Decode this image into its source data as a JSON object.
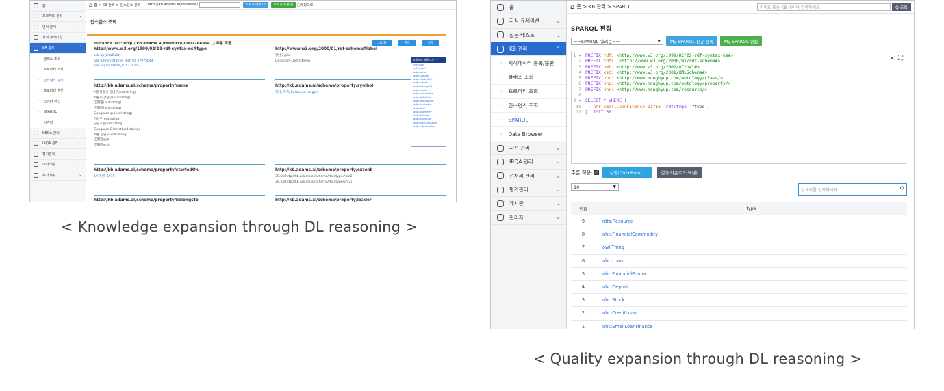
{
  "shot1": {
    "sidebar": [
      {
        "label": "홈",
        "active": false,
        "chev": false
      },
      {
        "label": "프로젝트 관리",
        "active": false,
        "chev": true
      },
      {
        "label": "언어 분석",
        "active": false,
        "chev": true
      },
      {
        "label": "지식 큐레이션",
        "active": false,
        "chev": true
      },
      {
        "label": "KB 관리",
        "active": true,
        "chev": true
      }
    ],
    "submenu": [
      {
        "label": "클래스 조회",
        "current": false
      },
      {
        "label": "프로퍼티 조회",
        "current": false
      },
      {
        "label": "인스턴스 관리",
        "current": true
      },
      {
        "label": "프로퍼티 추천",
        "current": false
      },
      {
        "label": "스키마 편집",
        "current": false
      },
      {
        "label": "SPARQL",
        "current": false
      },
      {
        "label": "시각화",
        "current": false
      }
    ],
    "sidebar_after": [
      {
        "label": "KBQA 관리"
      },
      {
        "label": "IRQA 관리"
      },
      {
        "label": "평가관리"
      },
      {
        "label": "모니터링"
      },
      {
        "label": "부가메뉴"
      }
    ],
    "breadcrumb": "홈 > KB 관리 > 인스턴스 관리",
    "url_text": "http://kb.adams.ai/resource/",
    "go_btn": "바로가기(新기)",
    "go_edit_btn": "바로가기(편집)",
    "new_window": "새창으로",
    "page_title": "인스턴스 조회",
    "instance_uri": "Instance URI: http://kb.adams.ai/resource/0000266994 □ 추론 적용",
    "action_buttons": [
      "시각화",
      "편집",
      "삭제"
    ],
    "cards": [
      {
        "head": "http://www.w3.org/1999/02/22-rdf-syntax-ns#type",
        "lines": [
          {
            "t": "adc:sp_GeoEntity -",
            "link": true
          },
          {
            "t": "adc:administrative_district_07975644 -",
            "link": true
          },
          {
            "t": "adc:organization_07523126 -",
            "link": true
          }
        ]
      },
      {
        "head": "http://www.w3.org/2000/01/rdf-schema#label",
        "lines": [
          {
            "t": "강남구@ko",
            "link": false
          },
          {
            "t": "Gangnam-District@en",
            "link": false
          }
        ]
      },
      {
        "head": "http://kb.adams.ai/schema/property/name",
        "lines": [
          {
            "t": "서울특별시 강남구(xsd:string)",
            "link": false
          },
          {
            "t": "서울시 강남구(xsd:string)",
            "link": false
          },
          {
            "t": "江南區(xsd:string)",
            "link": false
          },
          {
            "t": "江南区(xsd:string)",
            "link": false
          },
          {
            "t": "Gangnam-gu(xsd:string)",
            "link": false
          },
          {
            "t": "강남구(xsd:string)",
            "link": false
          },
          {
            "t": "강남구청(xsd:string)",
            "link": false
          },
          {
            "t": "Gangnam-District(xsd:string)",
            "link": false
          },
          {
            "t": "서울 강남구(xsd:string)",
            "link": false
          },
          {
            "t": "江南区@ja",
            "link": false
          },
          {
            "t": "江南区@zh",
            "link": false
          }
        ]
      },
      {
        "head": "http://kb.adams.ai/schema/property/symbol",
        "lines": [
          {
            "t": "까치, 까치, European magpie",
            "link": true
          }
        ]
      },
      {
        "head": "http://kb.adams.ai/schema/property/startedOn",
        "lines": [
          {
            "t": "1975년, 1975",
            "link": true
          }
        ]
      },
      {
        "head": "http://kb.adams.ai/schema/property/extent",
        "lines": [
          {
            "t": "39.55(http://kb.adams.ai/schema/datatype#km2)",
            "link": false
          },
          {
            "t": "39.55(http://kb.adams.ai/schema/datatype/km2)",
            "link": false
          }
        ]
      },
      {
        "head": "http://kb.adams.ai/schema/property/belongsTo",
        "lines": []
      },
      {
        "head": "http://kb.adams.ai/schema/property/leader",
        "lines": []
      }
    ],
    "dropdown_title": "프로퍼티 바로가기 ⋯",
    "dropdown_options": [
      "rdf:type",
      "rdfs:label",
      "adp:name",
      "adp:symbol",
      "adp:startedOn",
      "adp:extent",
      "adp:belongsTo",
      "adp:leader",
      "adp:coordinate",
      "adp:definition",
      "adp:description",
      "adp:locatedIn",
      "adp:field",
      "adp:geometry",
      "adp:latitude",
      "adp:longitude",
      "adp:mainLocation",
      "adp:subLocation"
    ]
  },
  "shot2": {
    "sidebar": [
      {
        "label": "홈",
        "active": false,
        "chev": false
      },
      {
        "label": "지식 큐레이션",
        "active": false,
        "chev": true
      },
      {
        "label": "질문 테스트",
        "active": false,
        "chev": true
      },
      {
        "label": "KB 관리",
        "active": true,
        "chev": true
      }
    ],
    "submenu": [
      {
        "label": "지식데이터 등록/출판",
        "current": false
      },
      {
        "label": "클래스 조회",
        "current": false
      },
      {
        "label": "프로퍼티 조회",
        "current": false
      },
      {
        "label": "인스턴스 조회",
        "current": false
      },
      {
        "label": "SPARQL",
        "current": true
      },
      {
        "label": "Data Browser",
        "current": false
      }
    ],
    "sidebar_after": [
      {
        "label": "사전 관리"
      },
      {
        "label": "IRQA 관리"
      },
      {
        "label": "전처리 관리"
      },
      {
        "label": "평가관리"
      },
      {
        "label": "게시판"
      },
      {
        "label": "관리자"
      }
    ],
    "breadcrumb": "홈 > KB 관리 > SPARQL",
    "search_placeholder": "키워드 또는 KB 데이터 입력하세요",
    "search_btn": "Q 조회",
    "page_title": "SPARQL 편집",
    "query_select": "==SPARQL 쿼리문==",
    "btn_register": "My SPARQL 신규 등록",
    "btn_edit": "My SPARQL 편집",
    "code": [
      {
        "no": "1 ▸",
        "parts": [
          [
            "kw",
            "PREFIX "
          ],
          [
            "vr",
            "rdf: "
          ],
          [
            "ur",
            "<http://www.w3.org/1999/02/22-rdf-syntax-ns#>"
          ]
        ]
      },
      {
        "no": "2",
        "parts": [
          [
            "kw",
            "PREFIX "
          ],
          [
            "vr",
            "rdfs: "
          ],
          [
            "ur",
            "<http://www.w3.org/2000/01/rdf-schema#>"
          ]
        ]
      },
      {
        "no": "3",
        "parts": [
          [
            "kw",
            "PREFIX "
          ],
          [
            "vr",
            "owl: "
          ],
          [
            "ur",
            "<http://www.w3.org/2002/07/owl#>"
          ]
        ]
      },
      {
        "no": "4",
        "parts": [
          [
            "kw",
            "PREFIX "
          ],
          [
            "vr",
            "xsd: "
          ],
          [
            "ur",
            "<http://www.w3.org/2001/XMLSchema#>"
          ]
        ]
      },
      {
        "no": "5",
        "parts": [
          [
            "kw",
            "PREFIX "
          ],
          [
            "vr",
            "nhc: "
          ],
          [
            "ur",
            "<http://www.nonghyup.com/ontology/class/>"
          ]
        ]
      },
      {
        "no": "6",
        "parts": [
          [
            "kw",
            "PREFIX "
          ],
          [
            "vr",
            "nhp: "
          ],
          [
            "ur",
            "<http://www.nonghyup.com/ontology/property/>"
          ]
        ]
      },
      {
        "no": "7",
        "parts": [
          [
            "kw",
            "PREFIX "
          ],
          [
            "vr",
            "nhr: "
          ],
          [
            "ur",
            "<http://www.nonghyup.com/resource/>"
          ]
        ]
      },
      {
        "no": "8",
        "parts": []
      },
      {
        "no": "9 ▸",
        "parts": [
          [
            "kw",
            "SELECT * WHERE {"
          ]
        ]
      },
      {
        "no": "10",
        "parts": [
          [
            "vr",
            "   nhr:SmallLoanFinance_11716  "
          ],
          [
            "kw",
            "rdf:type  "
          ],
          [
            "pl",
            "?type ."
          ]
        ]
      },
      {
        "no": "11",
        "parts": [
          [
            "kw",
            "} LIMIT 60"
          ]
        ]
      }
    ],
    "infer_label": "추론 적용:",
    "run_btn": "실행(Ctrl+Enter)",
    "download_btn": "결과 다운로드(엑셀)",
    "limit_value": "10",
    "filter_placeholder": "검색어를 입력하세요",
    "col_no": "번호",
    "col_type": "type",
    "rows": [
      {
        "no": "9",
        "type": "rdfs:Resource"
      },
      {
        "no": "8",
        "type": "nhc:FinancialCommodity"
      },
      {
        "no": "7",
        "type": "owl:Thing"
      },
      {
        "no": "6",
        "type": "nhc:Loan"
      },
      {
        "no": "5",
        "type": "nhc:FinancialProduct"
      },
      {
        "no": "4",
        "type": "nhc:Deposit"
      },
      {
        "no": "3",
        "type": "nhc:Stock"
      },
      {
        "no": "2",
        "type": "nhc:CreditLoan"
      },
      {
        "no": "1",
        "type": "nhc:SmallLoanFinance"
      }
    ]
  },
  "captions": {
    "left": "< Knowledge expansion through DL reasoning >",
    "right": "< Quality expansion through DL reasoning >"
  }
}
